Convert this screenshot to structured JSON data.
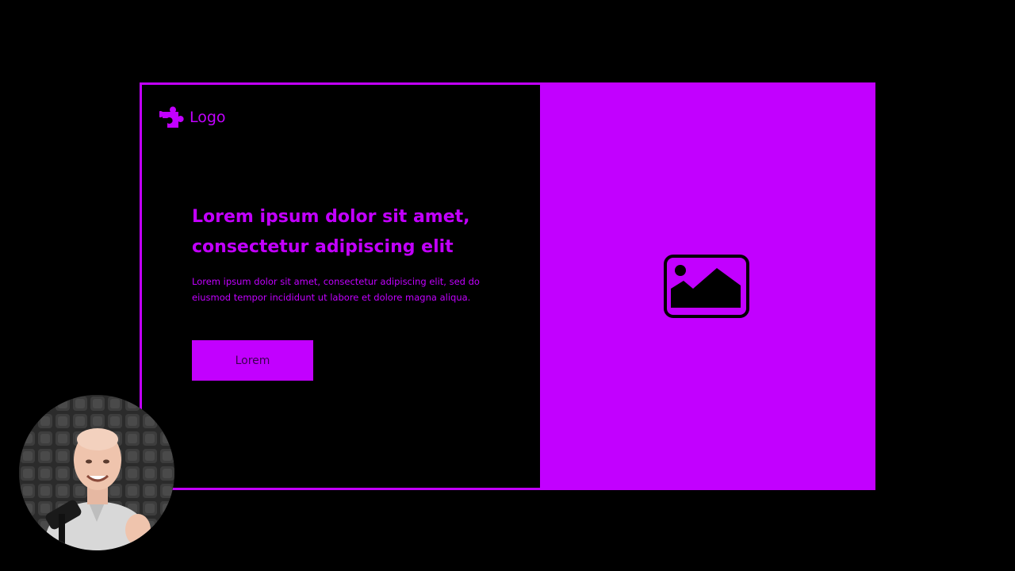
{
  "colors": {
    "accent": "#c200ff",
    "background": "#000000",
    "button_text": "#3a0050"
  },
  "hero": {
    "logo": {
      "icon": "puzzle-piece-icon",
      "text": "Logo"
    },
    "headline": "Lorem ipsum dolor sit amet, consectetur adipiscing elit",
    "body": "Lorem ipsum dolor sit amet, consectetur adipiscing elit, sed do eiusmod tempor incididunt ut labore et dolore magna aliqua.",
    "cta_label": "Lorem",
    "image_placeholder_icon": "image-icon"
  },
  "overlay": {
    "webcam_icon": "webcam-presenter"
  }
}
